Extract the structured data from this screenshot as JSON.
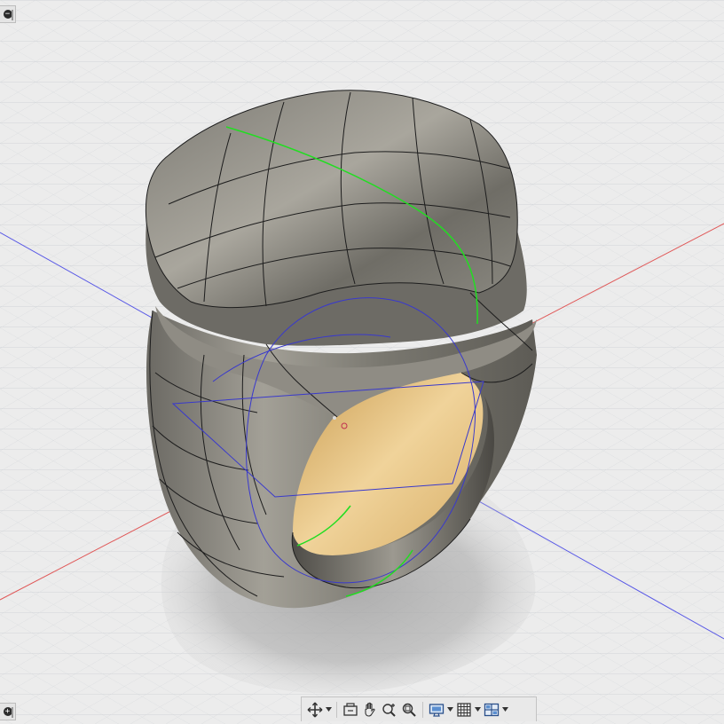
{
  "viewport": {
    "background": "#ececec",
    "grid_color": "#cfd2d6",
    "axis_colors": {
      "x": "#e05050",
      "y": "#5656e0"
    },
    "model": {
      "body_color": "#8a877f",
      "inner_color": "#e0b872",
      "wire_color": "#1a1a1a",
      "highlight_color": "#22dd22",
      "sketch_color": "#3a3ad0"
    }
  },
  "corner_controls": {
    "top": {
      "icon": "minus-icon",
      "glyph": "−"
    },
    "bottom": {
      "icon": "plus-icon",
      "glyph": "+"
    }
  },
  "nav_toolbar": {
    "items": [
      {
        "icon": "orbit-icon",
        "has_menu": true
      },
      {
        "icon": "look-at-icon",
        "has_menu": false
      },
      {
        "icon": "pan-icon",
        "has_menu": false
      },
      {
        "icon": "zoom-icon",
        "has_menu": false
      },
      {
        "icon": "fit-window-icon",
        "has_menu": false
      },
      {
        "icon": "display-settings-icon",
        "has_menu": true
      },
      {
        "icon": "grid-snaps-icon",
        "has_menu": true
      },
      {
        "icon": "viewports-icon",
        "has_menu": true
      }
    ]
  }
}
